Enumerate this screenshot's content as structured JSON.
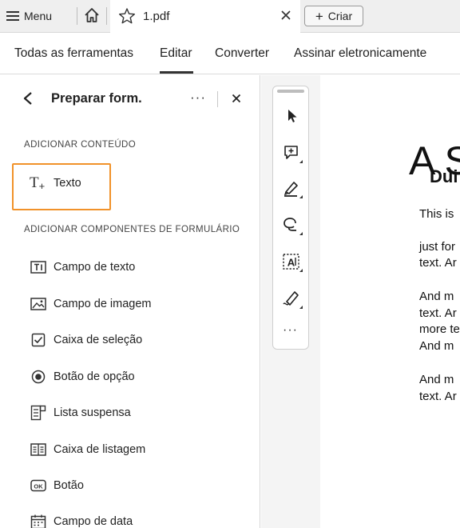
{
  "titlebar": {
    "menu_label": "Menu",
    "home_icon": "home-icon",
    "tab_title": "1.pdf",
    "star_icon": "star-icon",
    "close_icon": "close-icon",
    "criar_label": "Criar"
  },
  "topnav": {
    "items": [
      "Todas as ferramentas",
      "Editar",
      "Converter",
      "Assinar eletronicamente"
    ],
    "active": "Editar"
  },
  "panel": {
    "title": "Preparar form.",
    "more": "···",
    "section_content": "ADICIONAR CONTEÚDO",
    "texto_label": "Texto",
    "section_form": "ADICIONAR COMPONENTES DE FORMULÁRIO",
    "items": [
      {
        "label": "Campo de texto",
        "icon": "text-field-icon"
      },
      {
        "label": "Campo de imagem",
        "icon": "image-field-icon"
      },
      {
        "label": "Caixa de seleção",
        "icon": "checkbox-icon"
      },
      {
        "label": "Botão de opção",
        "icon": "radio-button-icon"
      },
      {
        "label": "Lista suspensa",
        "icon": "dropdown-list-icon"
      },
      {
        "label": "Caixa de listagem",
        "icon": "list-box-icon"
      },
      {
        "label": "Botão",
        "icon": "button-icon"
      },
      {
        "label": "Campo de data",
        "icon": "date-field-icon"
      }
    ]
  },
  "toolbar": {
    "tools": [
      "select-cursor-icon",
      "add-comment-icon",
      "highlight-pen-icon",
      "draw-lasso-icon",
      "text-recognition-icon",
      "sign-pen-icon"
    ],
    "more": "···"
  },
  "document": {
    "heading_fragment": "A S",
    "subheading_fragment": "Dui",
    "lines": [
      "This is",
      "just for",
      "text. Ar",
      "And m",
      "text. Ar",
      "more te",
      "And m",
      "And m",
      "text. Ar"
    ]
  },
  "colors": {
    "accent_orange": "#f1922a",
    "titlebar_bg": "#efefef",
    "canvas_bg": "#f4f4f4"
  }
}
